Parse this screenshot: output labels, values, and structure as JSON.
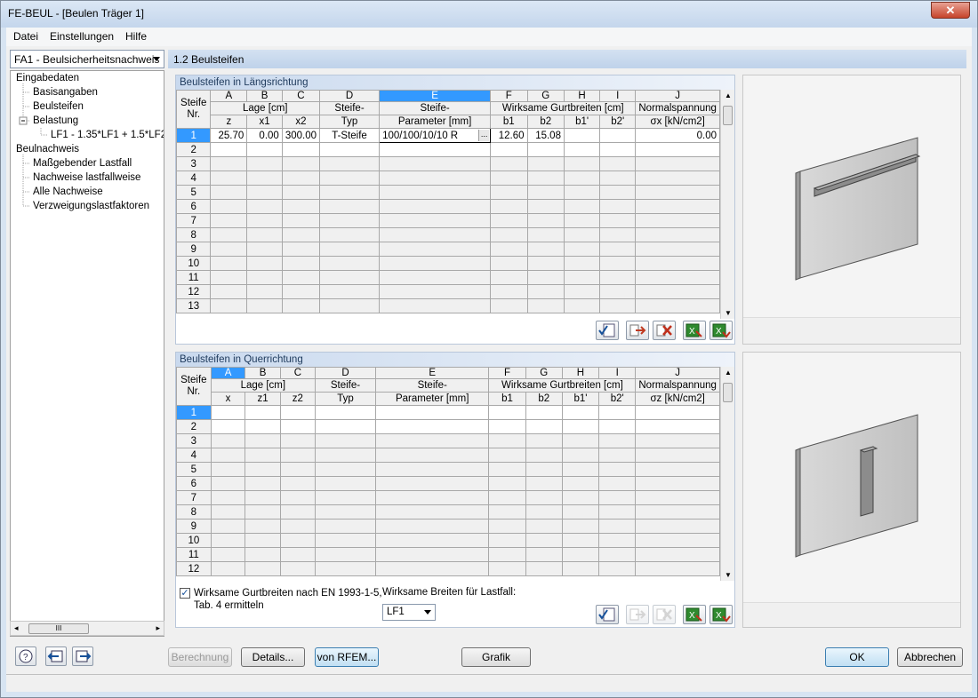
{
  "window": {
    "title": "FE-BEUL - [Beulen Träger 1]",
    "close": "✕"
  },
  "menu": [
    {
      "label": "Datei"
    },
    {
      "label": "Einstellungen"
    },
    {
      "label": "Hilfe"
    }
  ],
  "nav": {
    "case_select": "FA1 - Beulsicherheitsnachweis",
    "tree": [
      {
        "label": "Eingabedaten"
      },
      {
        "label": "Basisangaben"
      },
      {
        "label": "Beulsteifen"
      },
      {
        "label": "Belastung"
      },
      {
        "label": "LF1 - 1.35*LF1 + 1.5*LF2 +"
      },
      {
        "label": "Beulnachweis"
      },
      {
        "label": "Maßgebender Lastfall"
      },
      {
        "label": "Nachweise lastfallweise"
      },
      {
        "label": "Alle Nachweise"
      },
      {
        "label": "Verzweigungslastfaktoren"
      }
    ],
    "expander": "−",
    "scroll_thumb": "III"
  },
  "page_title": "1.2 Beulsteifen",
  "long": {
    "title": "Beulsteifen in Längsrichtung",
    "col_letters": [
      "A",
      "B",
      "C",
      "D",
      "E",
      "F",
      "G",
      "H",
      "I",
      "J"
    ],
    "hdr_steife": "Steife",
    "hdr_nr": "Nr.",
    "hdr_lage": "Lage [cm]",
    "hdr_typ1": "Steife-",
    "hdr_typ2": "Typ",
    "hdr_par1": "Steife-",
    "hdr_par2": "Parameter [mm]",
    "hdr_wirk": "Wirksame Gurtbreiten [cm]",
    "hdr_norm1": "Normalspannung",
    "hdr_norm2": "σx [kN/cm2]",
    "sub": [
      "z",
      "x1",
      "x2",
      "b1",
      "b2",
      "b1'",
      "b2'"
    ],
    "rows": [
      "1",
      "2",
      "3",
      "4",
      "5",
      "6",
      "7",
      "8",
      "9",
      "10",
      "11",
      "12",
      "13"
    ],
    "row1": {
      "z": "25.70",
      "x1": "0.00",
      "x2": "300.00",
      "typ": "T-Steife",
      "par": "100/100/10/10 R",
      "b1": "12.60",
      "b2": "15.08",
      "sigma": "0.00"
    }
  },
  "quer": {
    "title": "Beulsteifen in Querrichtung",
    "hdr_norm2": "σz [kN/cm2]",
    "sub": [
      "x",
      "z1",
      "z2",
      "b1",
      "b2",
      "b1'",
      "b2'"
    ],
    "rows": [
      "1",
      "2",
      "3",
      "4",
      "5",
      "6",
      "7",
      "8",
      "9",
      "10",
      "11",
      "12"
    ]
  },
  "options": {
    "checkbox_label_1": "Wirksame Gurtbreiten nach EN 1993-1-5,",
    "checkbox_label_2": "Tab. 4 ermitteln",
    "checked": true,
    "lf_label": "Wirksame Breiten für Lastfall:",
    "lf_value": "LF1"
  },
  "buttons": {
    "berechnung": "Berechnung",
    "details": "Details...",
    "von_rfem": "von RFEM...",
    "grafik": "Grafik",
    "ok": "OK",
    "abbrechen": "Abbrechen"
  },
  "colors": {
    "selection": "#3399ff",
    "header_band": "#c9d9ee"
  }
}
